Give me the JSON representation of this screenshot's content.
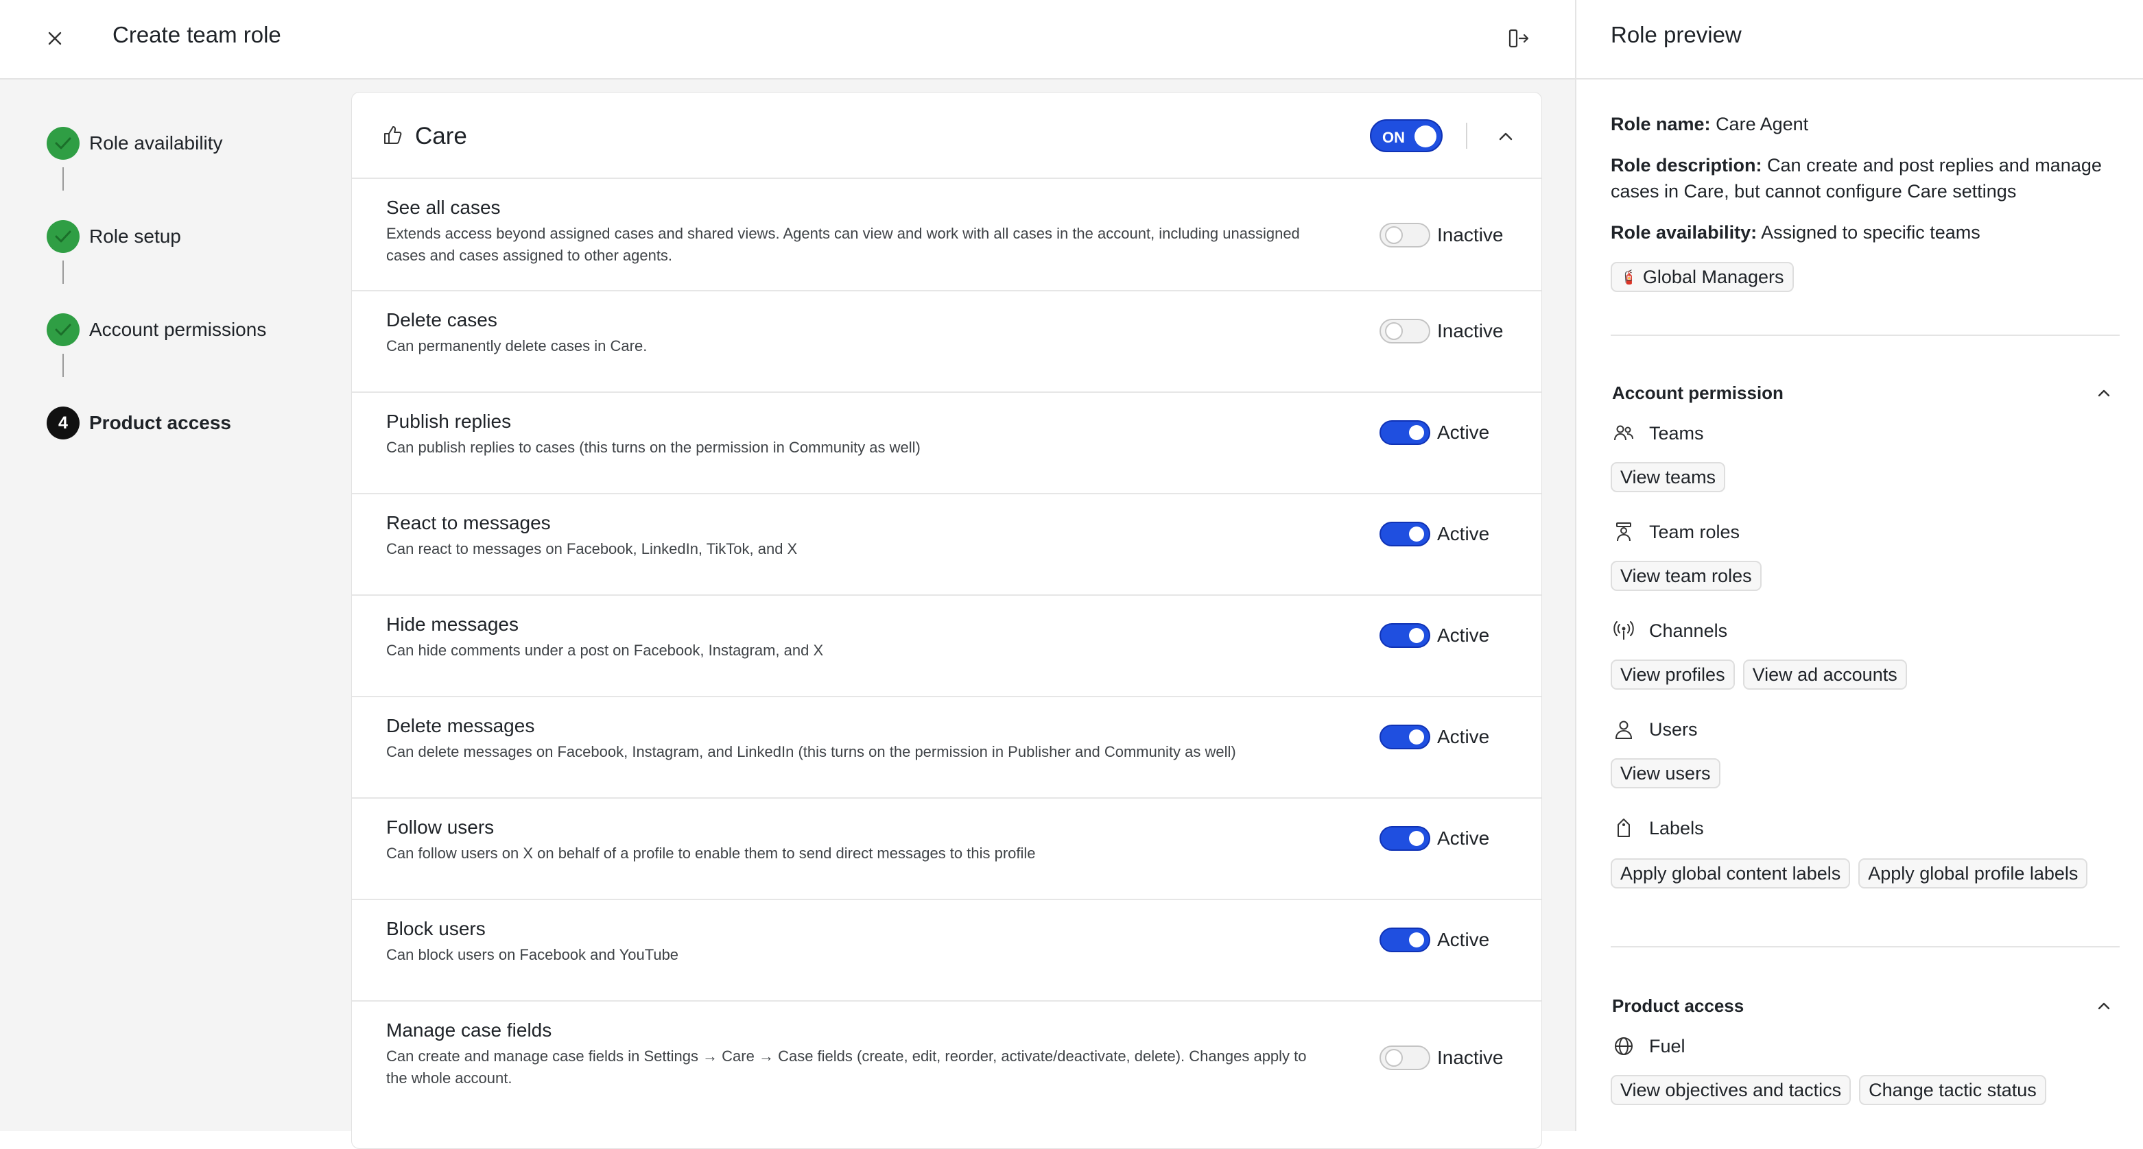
{
  "header": {
    "title": "Create team role"
  },
  "stepper": {
    "steps": [
      {
        "label": "Role availability",
        "state": "done"
      },
      {
        "label": "Role setup",
        "state": "done"
      },
      {
        "label": "Account permissions",
        "state": "done"
      },
      {
        "label": "Product access",
        "state": "current",
        "number": "4"
      }
    ]
  },
  "care": {
    "title": "Care",
    "toggle_label": "ON",
    "permissions": [
      {
        "title": "See all cases",
        "description": "Extends access beyond assigned cases and shared views. Agents can view and work with all cases in the account, including unassigned cases and cases assigned to other agents.",
        "status": "Inactive"
      },
      {
        "title": "Delete cases",
        "description": "Can permanently delete cases in Care.",
        "status": "Inactive"
      },
      {
        "title": "Publish replies",
        "description": "Can publish replies to cases (this turns on the permission in Community as well)",
        "status": "Active"
      },
      {
        "title": "React to messages",
        "description": "Can react to messages on Facebook, LinkedIn, TikTok, and X",
        "status": "Active"
      },
      {
        "title": "Hide messages",
        "description": "Can hide comments under a post on Facebook, Instagram, and X",
        "status": "Active"
      },
      {
        "title": "Delete messages",
        "description": "Can delete messages on Facebook, Instagram, and LinkedIn (this turns on the permission in Publisher and Community as well)",
        "status": "Active"
      },
      {
        "title": "Follow users",
        "description": "Can follow users on X on behalf of a profile to enable them to send direct messages to this profile",
        "status": "Active"
      },
      {
        "title": "Block users",
        "description": "Can block users on Facebook and YouTube",
        "status": "Active"
      },
      {
        "title": "Manage case fields",
        "description": "Can create and manage case fields in Settings → Care → Case fields (create, edit, reorder, activate/deactivate, delete). Changes apply to the whole account.",
        "status": "Inactive"
      }
    ]
  },
  "preview": {
    "title": "Role preview",
    "role_name_label": "Role name:",
    "role_name": "Care Agent",
    "role_description_label": "Role description:",
    "role_description": "Can create and post replies and manage cases in Care, but cannot configure Care settings",
    "role_availability_label": "Role availability:",
    "role_availability": "Assigned to specific teams",
    "team_chip": "Global Managers",
    "account_permission": {
      "title": "Account permission",
      "groups": [
        {
          "name": "Teams",
          "icon": "people-icon",
          "chips": [
            "View teams"
          ]
        },
        {
          "name": "Team roles",
          "icon": "role-icon",
          "chips": [
            "View team roles"
          ]
        },
        {
          "name": "Channels",
          "icon": "broadcast-icon",
          "chips": [
            "View profiles",
            "View ad accounts"
          ]
        },
        {
          "name": "Users",
          "icon": "user-icon",
          "chips": [
            "View users"
          ]
        },
        {
          "name": "Labels",
          "icon": "tag-icon",
          "chips": [
            "Apply global content labels",
            "Apply global profile labels"
          ]
        }
      ]
    },
    "product_access": {
      "title": "Product access",
      "groups": [
        {
          "name": "Fuel",
          "icon": "fuel-icon",
          "chips": [
            "View objectives and tactics",
            "Change tactic status"
          ]
        }
      ]
    }
  },
  "colors": {
    "accent": "#1f4fe0",
    "success": "#2f9e44",
    "panel_bg": "#f4f4f4"
  }
}
